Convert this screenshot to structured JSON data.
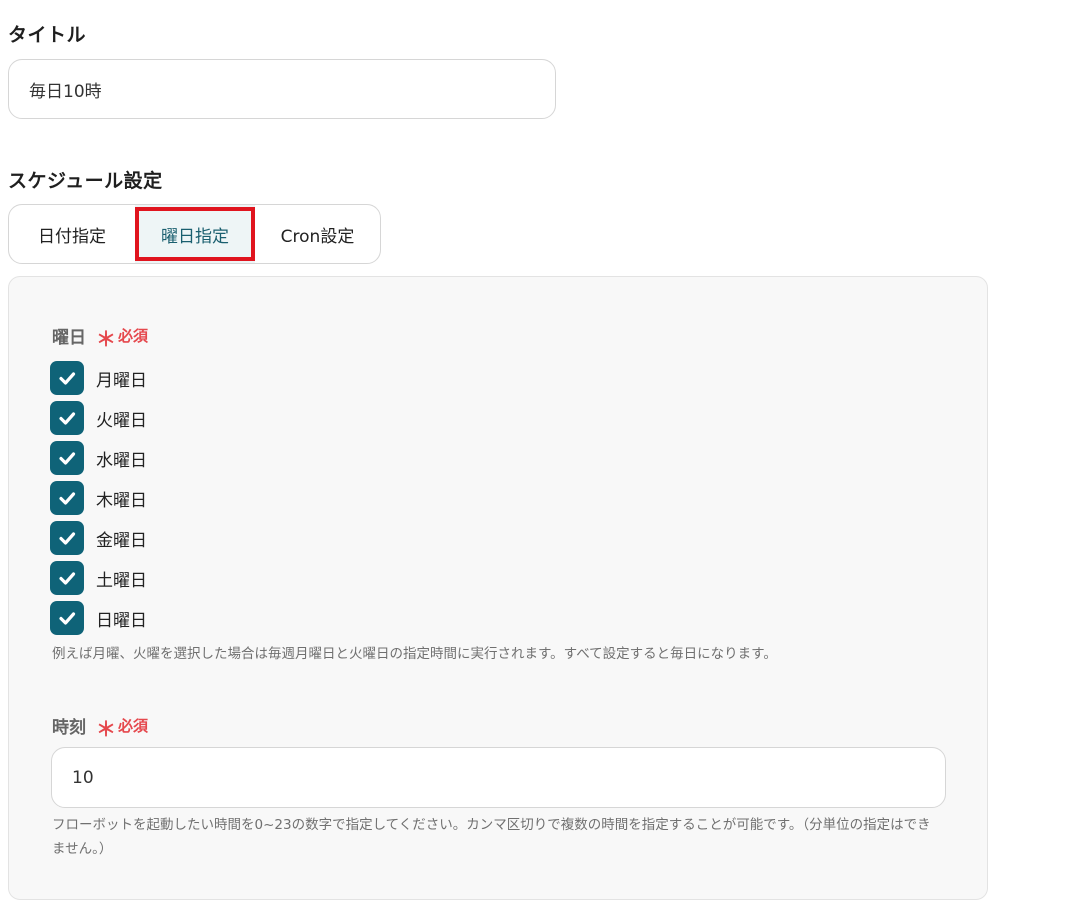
{
  "title_section": {
    "label": "タイトル",
    "value": "毎日10時"
  },
  "schedule_section": {
    "label": "スケジュール設定",
    "tabs": [
      {
        "label": "日付指定",
        "selected": false
      },
      {
        "label": "曜日指定",
        "selected": true
      },
      {
        "label": "Cron設定",
        "selected": false
      }
    ],
    "highlight_color": "#e0141e"
  },
  "weekday_field": {
    "label": "曜日",
    "required_mark": "＊",
    "required_text": "必須",
    "options": [
      {
        "label": "月曜日",
        "checked": true
      },
      {
        "label": "火曜日",
        "checked": true
      },
      {
        "label": "水曜日",
        "checked": true
      },
      {
        "label": "木曜日",
        "checked": true
      },
      {
        "label": "金曜日",
        "checked": true
      },
      {
        "label": "土曜日",
        "checked": true
      },
      {
        "label": "日曜日",
        "checked": true
      }
    ],
    "help": "例えば月曜、火曜を選択した場合は毎週月曜日と火曜日の指定時間に実行されます。すべて設定すると毎日になります。"
  },
  "time_field": {
    "label": "時刻",
    "required_mark": "＊",
    "required_text": "必須",
    "value": "10",
    "help": "フローボットを起動したい時間を0~23の数字で指定してください。カンマ区切りで複数の時間を指定することが可能です。（分単位の指定はできません。）"
  },
  "colors": {
    "checkbox": "#0f6378",
    "required": "#e5484d",
    "selected_tab_text": "#1a5f6f"
  },
  "icons": {
    "checkbox_mark": "checkmark-icon",
    "required_mark": "asterisk-icon"
  }
}
